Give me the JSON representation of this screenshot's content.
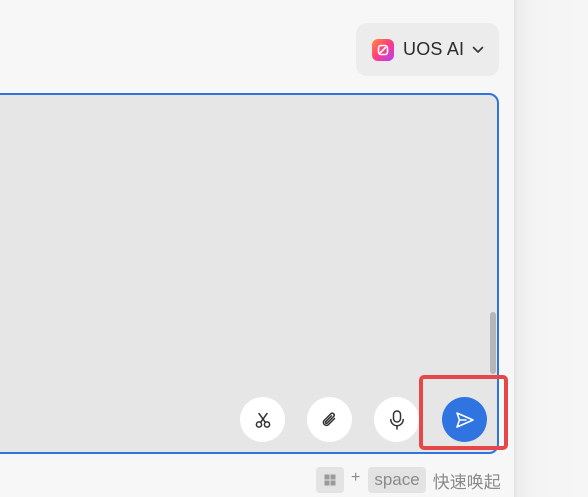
{
  "model_selector": {
    "logo_icon": "uos-ai-logo-icon",
    "label": "UOS AI",
    "chevron_icon": "chevron-down-icon"
  },
  "input": {
    "placeholder": "",
    "value": ""
  },
  "toolbar": {
    "screenshot_icon": "scissors-icon",
    "attach_icon": "paperclip-icon",
    "voice_icon": "microphone-icon",
    "send_icon": "send-icon"
  },
  "shortcut_hint": {
    "win_key_icon": "windows-key-icon",
    "plus": "+",
    "space_key": "space",
    "text": "快速唤起"
  },
  "colors": {
    "accent": "#2f74e0",
    "highlight": "#e54848",
    "input_background": "#e6e6e6"
  }
}
